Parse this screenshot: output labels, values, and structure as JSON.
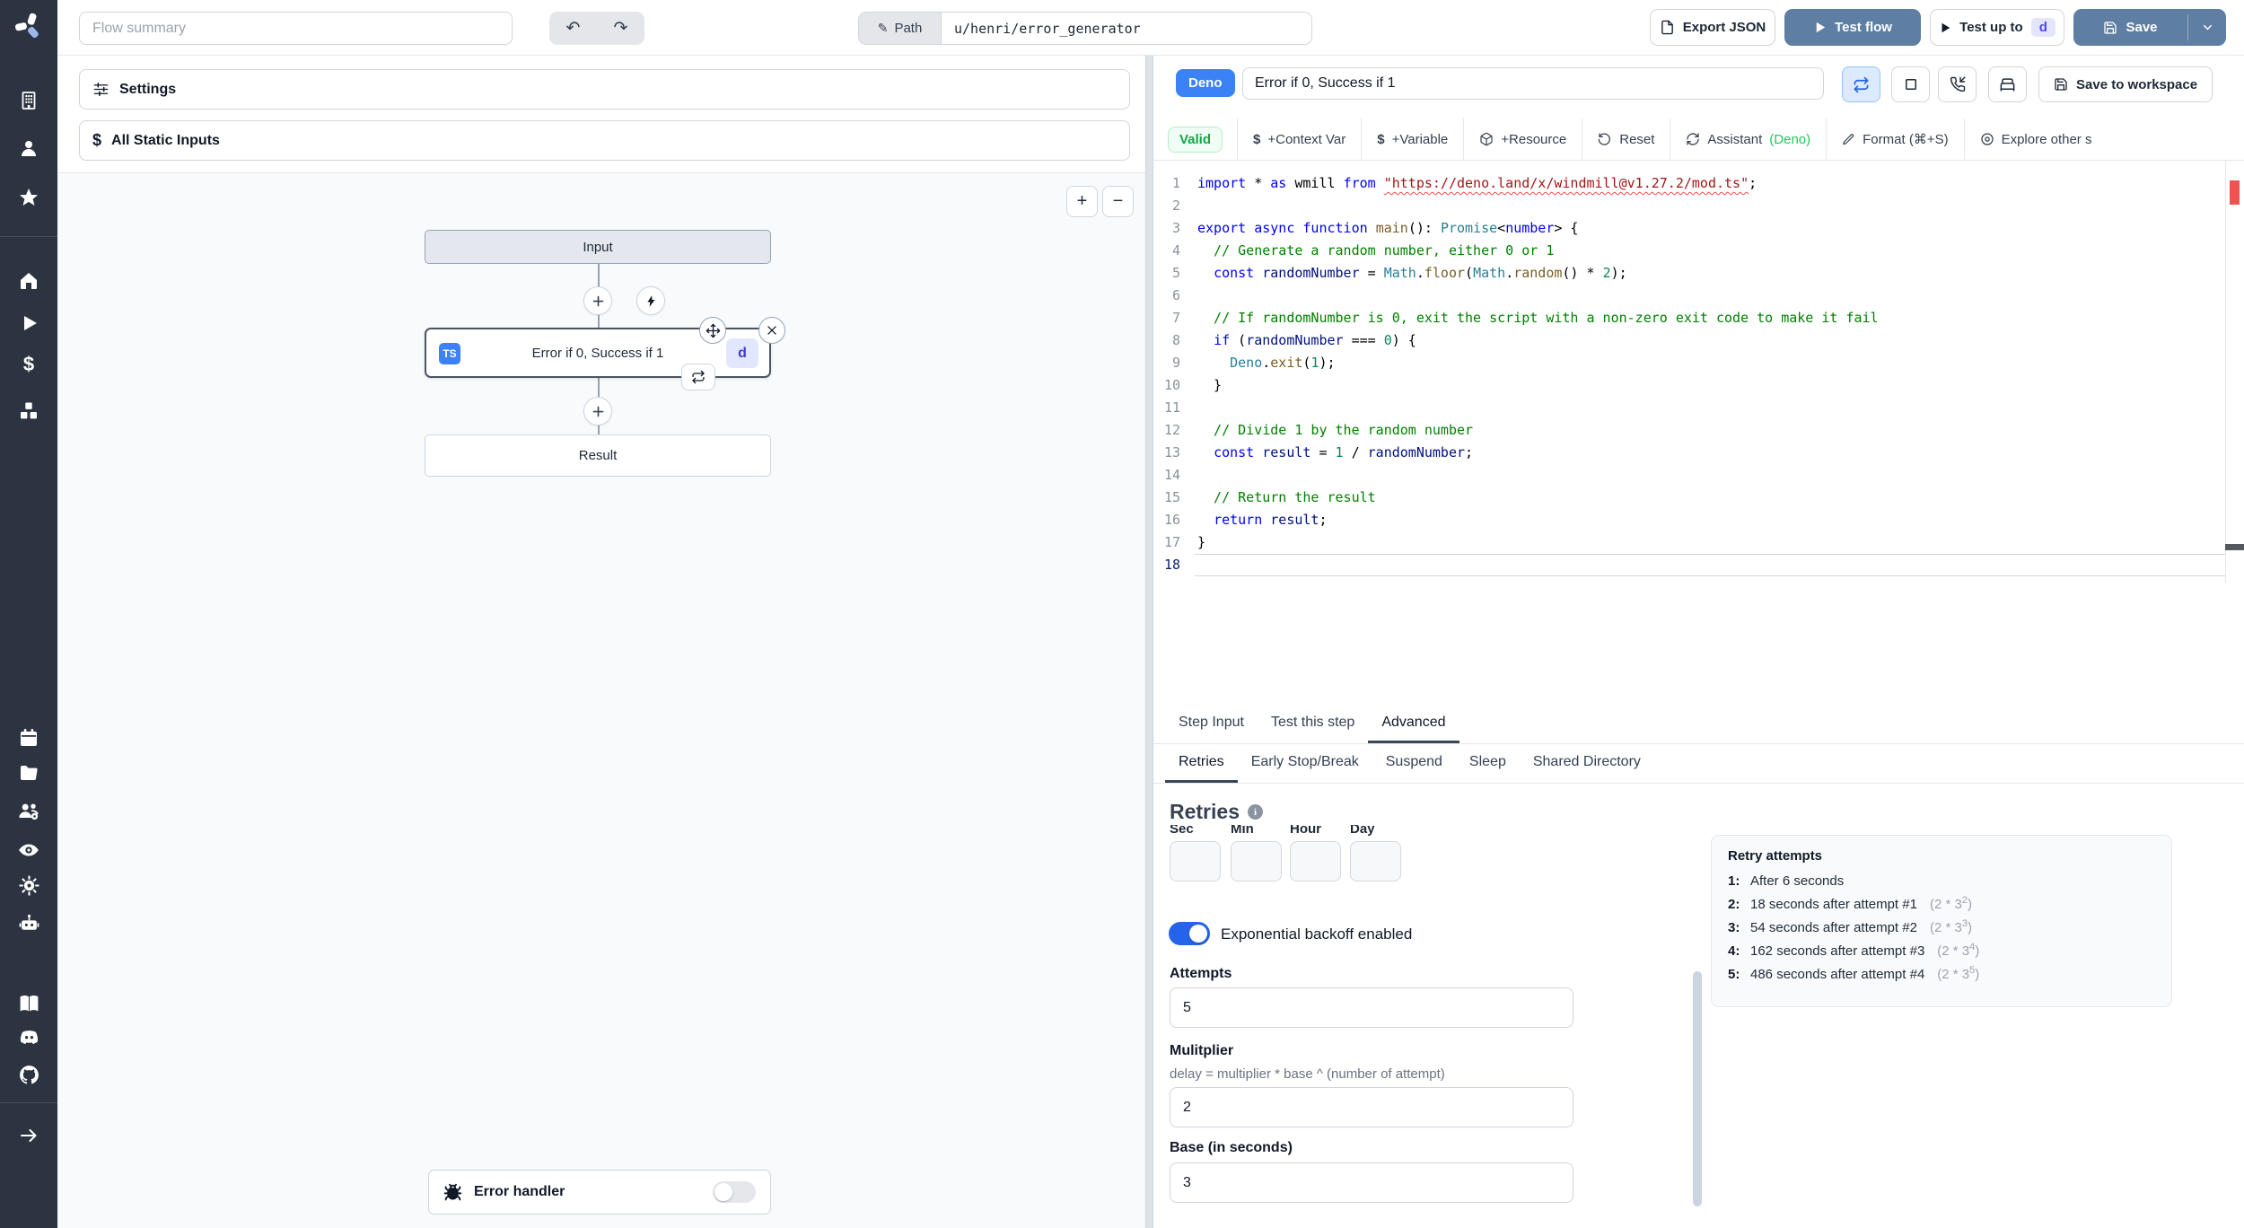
{
  "topbar": {
    "flow_summary_placeholder": "Flow summary",
    "path_label": "Path",
    "path_value": "u/henri/error_generator",
    "export_json": "Export JSON",
    "test_flow": "Test flow",
    "test_up_to": "Test up to",
    "test_up_to_badge": "d",
    "save": "Save"
  },
  "flow": {
    "settings": "Settings",
    "all_static_inputs": "All Static Inputs",
    "input_node": "Input",
    "step_node": "Error if 0, Success if 1",
    "step_lang_badge": "TS",
    "step_id_badge": "d",
    "result_node": "Result",
    "error_handler": "Error handler",
    "zoom_in": "+",
    "zoom_out": "−"
  },
  "editor_header": {
    "lang_badge": "Deno",
    "step_name": "Error if 0, Success if 1",
    "save_to_workspace": "Save to workspace"
  },
  "toolbar": {
    "valid": "Valid",
    "context_var": "+Context Var",
    "variable": "+Variable",
    "resource": "+Resource",
    "reset": "Reset",
    "assistant": "Assistant",
    "assistant_lang": "(Deno)",
    "format": "Format (⌘+S)",
    "explore": "Explore other s",
    "dollar": "$"
  },
  "code": {
    "lines": [
      [
        [
          "k",
          "import"
        ],
        [
          "p",
          " * "
        ],
        [
          "k",
          "as"
        ],
        [
          "p",
          " wmill "
        ],
        [
          "k",
          "from"
        ],
        [
          "p",
          " "
        ],
        [
          "s",
          "\"https://deno.land/x/windmill@v1.27.2/mod.ts\""
        ],
        [
          "p",
          ";"
        ]
      ],
      [],
      [
        [
          "k",
          "export"
        ],
        [
          "p",
          " "
        ],
        [
          "k",
          "async"
        ],
        [
          "p",
          " "
        ],
        [
          "k",
          "function"
        ],
        [
          "p",
          " "
        ],
        [
          "f",
          "main"
        ],
        [
          "p",
          "(): "
        ],
        [
          "t",
          "Promise"
        ],
        [
          "p",
          "<"
        ],
        [
          "k",
          "number"
        ],
        [
          "p",
          "> {"
        ]
      ],
      [
        [
          "c",
          "  // Generate a random number, either 0 or 1"
        ]
      ],
      [
        [
          "p",
          "  "
        ],
        [
          "k",
          "const"
        ],
        [
          "p",
          " "
        ],
        [
          "v",
          "randomNumber"
        ],
        [
          "p",
          " = "
        ],
        [
          "t",
          "Math"
        ],
        [
          "p",
          "."
        ],
        [
          "f",
          "floor"
        ],
        [
          "p",
          "("
        ],
        [
          "t",
          "Math"
        ],
        [
          "p",
          "."
        ],
        [
          "f",
          "random"
        ],
        [
          "p",
          "() * "
        ],
        [
          "n",
          "2"
        ],
        [
          "p",
          ");"
        ]
      ],
      [],
      [
        [
          "c",
          "  // If randomNumber is 0, exit the script with a non-zero exit code to make it fail"
        ]
      ],
      [
        [
          "p",
          "  "
        ],
        [
          "k",
          "if"
        ],
        [
          "p",
          " ("
        ],
        [
          "v",
          "randomNumber"
        ],
        [
          "p",
          " === "
        ],
        [
          "n",
          "0"
        ],
        [
          "p",
          ") {"
        ]
      ],
      [
        [
          "p",
          "    "
        ],
        [
          "t",
          "Deno"
        ],
        [
          "p",
          "."
        ],
        [
          "f",
          "exit"
        ],
        [
          "p",
          "("
        ],
        [
          "n",
          "1"
        ],
        [
          "p",
          ");"
        ]
      ],
      [
        [
          "p",
          "  }"
        ]
      ],
      [],
      [
        [
          "c",
          "  // Divide 1 by the random number"
        ]
      ],
      [
        [
          "p",
          "  "
        ],
        [
          "k",
          "const"
        ],
        [
          "p",
          " "
        ],
        [
          "v",
          "result"
        ],
        [
          "p",
          " = "
        ],
        [
          "n",
          "1"
        ],
        [
          "p",
          " / "
        ],
        [
          "v",
          "randomNumber"
        ],
        [
          "p",
          ";"
        ]
      ],
      [],
      [
        [
          "c",
          "  // Return the result"
        ]
      ],
      [
        [
          "p",
          "  "
        ],
        [
          "k",
          "return"
        ],
        [
          "p",
          " "
        ],
        [
          "v",
          "result"
        ],
        [
          "p",
          ";"
        ]
      ],
      [
        [
          "p",
          "}"
        ]
      ],
      []
    ]
  },
  "tabs": {
    "primary": [
      "Step Input",
      "Test this step",
      "Advanced"
    ],
    "secondary": [
      "Retries",
      "Early Stop/Break",
      "Suspend",
      "Sleep",
      "Shared Directory"
    ]
  },
  "retries": {
    "title": "Retries",
    "time_labels": [
      "Sec",
      "Min",
      "Hour",
      "Day"
    ],
    "backoff_label": "Exponential backoff enabled",
    "attempts_label": "Attempts",
    "attempts_value": "5",
    "multiplier_label": "Mulitplier",
    "multiplier_help": "delay = multiplier * base ^ (number of attempt)",
    "multiplier_value": "2",
    "base_label": "Base (in seconds)",
    "base_value": "3",
    "panel": {
      "title": "Retry attempts",
      "rows": [
        {
          "n": "1:",
          "text": "After 6 seconds",
          "fb": "",
          "fe": "",
          "fc": ""
        },
        {
          "n": "2:",
          "text": "18 seconds after attempt #1",
          "fb": "(2 * 3",
          "fe": "2",
          "fc": ")"
        },
        {
          "n": "3:",
          "text": "54 seconds after attempt #2",
          "fb": "(2 * 3",
          "fe": "3",
          "fc": ")"
        },
        {
          "n": "4:",
          "text": "162 seconds after attempt #3",
          "fb": "(2 * 3",
          "fe": "4",
          "fc": ")"
        },
        {
          "n": "5:",
          "text": "486 seconds after attempt #4",
          "fb": "(2 * 3",
          "fe": "5",
          "fc": ")"
        }
      ]
    }
  },
  "colors": {
    "primary_button": "#5e7fa3",
    "deno_badge": "#3b82f6",
    "valid_green": "#17a34a",
    "toggle_on": "#2563eb",
    "sidebar_bg": "#2d3441"
  },
  "icons": {
    "sidebar": [
      "windmill-logo",
      "building",
      "user",
      "star",
      "home",
      "play",
      "dollar",
      "boxes",
      "calendar",
      "folder",
      "user-group-gear",
      "eye",
      "gear",
      "robot",
      "book",
      "discord",
      "github",
      "arrow-right"
    ]
  }
}
